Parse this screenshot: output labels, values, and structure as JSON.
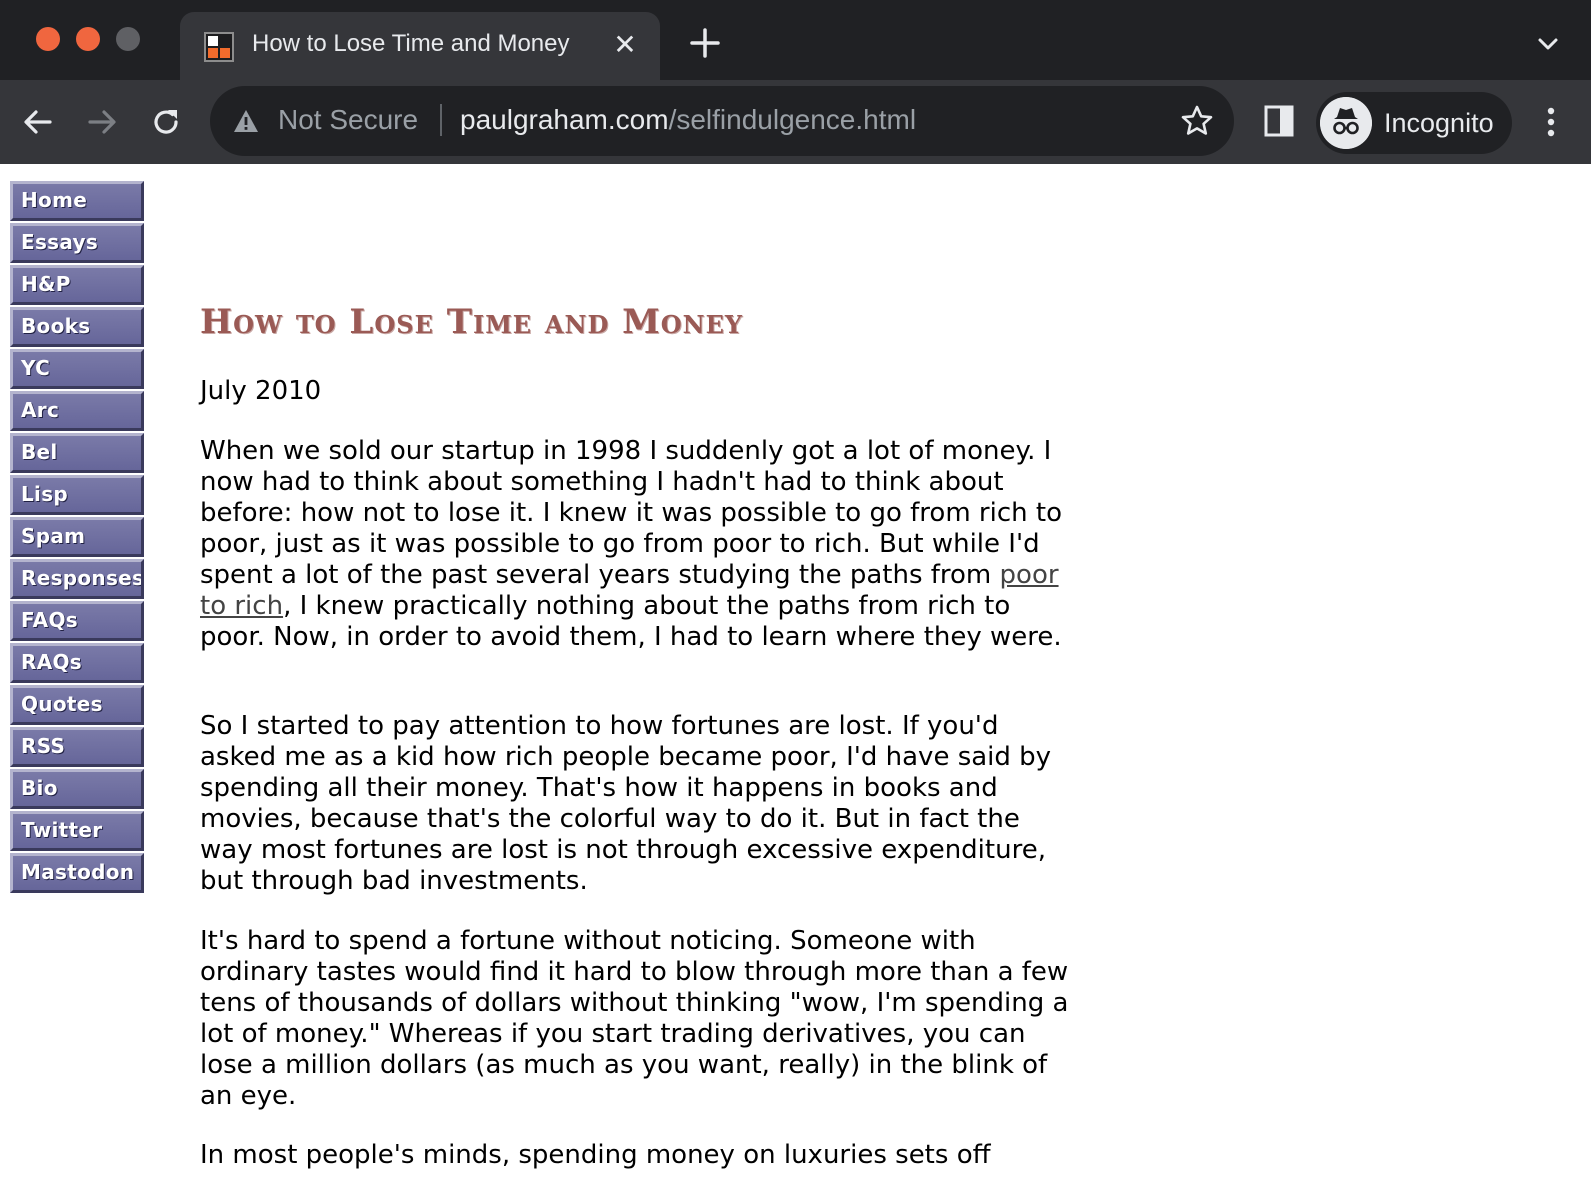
{
  "browser": {
    "tab": {
      "title": "How to Lose Time and Money",
      "close_glyph": "✕"
    },
    "toolbar": {
      "security_label": "Not Secure",
      "url_host": "paulgraham.com",
      "url_path": "/selfindulgence.html",
      "profile_label": "Incognito"
    },
    "icons": [
      "back-icon",
      "forward-icon",
      "reload-icon",
      "warning-icon",
      "star-icon",
      "side-panel-icon",
      "incognito-icon",
      "more-menu-icon",
      "new-tab-icon",
      "tab-list-icon"
    ],
    "colors": {
      "chrome_dark": "#202124",
      "chrome_mid": "#35363a",
      "traffic_red": "#f0663f",
      "favicon_orange": "#f26b2c"
    }
  },
  "sidebar": {
    "items": [
      {
        "label": "Home"
      },
      {
        "label": "Essays"
      },
      {
        "label": "H&P"
      },
      {
        "label": "Books"
      },
      {
        "label": "YC"
      },
      {
        "label": "Arc"
      },
      {
        "label": "Bel"
      },
      {
        "label": "Lisp"
      },
      {
        "label": "Spam"
      },
      {
        "label": "Responses"
      },
      {
        "label": "FAQs"
      },
      {
        "label": "RAQs"
      },
      {
        "label": "Quotes"
      },
      {
        "label": "RSS"
      },
      {
        "label": "Bio"
      },
      {
        "label": "Twitter"
      },
      {
        "label": "Mastodon"
      }
    ],
    "colors": {
      "button_face": "#6e6ea0",
      "title_color": "#9a5a55"
    }
  },
  "article": {
    "title": "How to Lose Time and Money",
    "date": "July 2010",
    "p1_before_link": "When we sold our startup in 1998 I suddenly got a lot of money. I now had to think about something I hadn't had to think about before: how not to lose it. I knew it was possible to go from rich to poor, just as it was possible to go from poor to rich. But while I'd spent a lot of the past several years studying the paths from ",
    "p1_link": "poor to rich",
    "p1_after_link": ", I knew practically nothing about the paths from rich to poor. Now, in order to avoid them, I had to learn where they were.",
    "p2": "So I started to pay attention to how fortunes are lost. If you'd asked me as a kid how rich people became poor, I'd have said by spending all their money. That's how it happens in books and movies, because that's the colorful way to do it. But in fact the way most fortunes are lost is not through excessive expenditure, but through bad investments.",
    "p3": "It's hard to spend a fortune without noticing. Someone with ordinary tastes would find it hard to blow through more than a few tens of thousands of dollars without thinking \"wow, I'm spending a lot of money.\" Whereas if you start trading derivatives, you can lose a million dollars (as much as you want, really) in the blink of an eye.",
    "p4": "In most people's minds, spending money on luxuries sets off"
  }
}
